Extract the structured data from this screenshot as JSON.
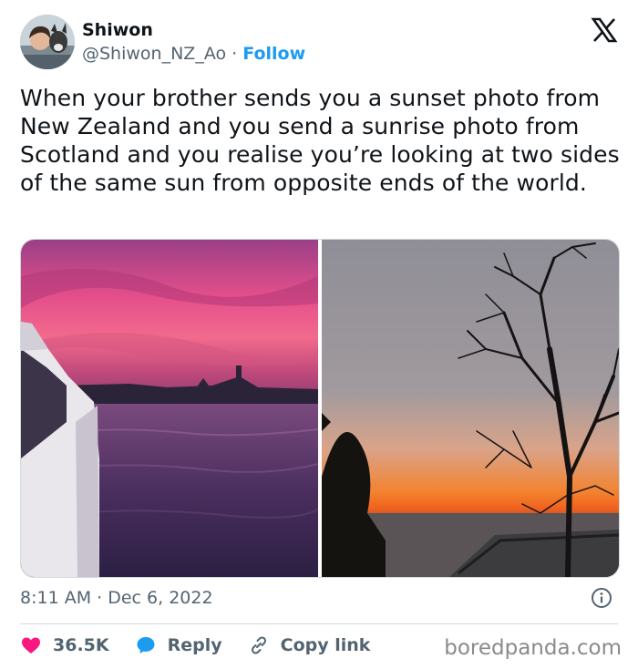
{
  "author": {
    "display_name": "Shiwon",
    "handle": "@Shiwon_NZ_Ao",
    "separator": "·",
    "follow_label": "Follow"
  },
  "tweet": {
    "text": "When your brother sends you a sunset photo from New Zealand and you send a sunrise photo from Scotland and you realise you’re looking at two sides of the same sun from opposite ends of the world.",
    "timestamp": "8:11 AM · Dec 6, 2022"
  },
  "actions": {
    "likes_count": "36.5K",
    "reply_label": "Reply",
    "copy_link_label": "Copy link"
  },
  "icons": [
    "x-logo-icon",
    "info-icon",
    "heart-icon",
    "reply-bubble-icon",
    "link-icon"
  ],
  "colors": {
    "accent": "#1d9bf0",
    "like": "#f91880",
    "secondary_text": "#536471",
    "border": "#cfd9de"
  },
  "watermark": "boredpanda.com"
}
